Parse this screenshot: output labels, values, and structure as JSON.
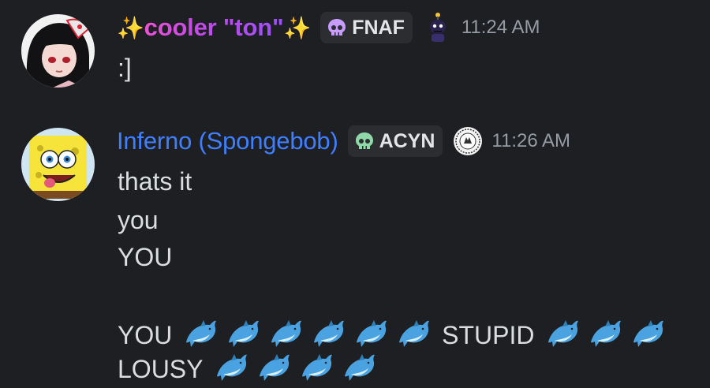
{
  "messages": [
    {
      "author": "cooler \"ton\"",
      "author_prefix": "✨",
      "author_suffix": "✨",
      "author_color": "#c64ae6",
      "tag": "FNAF",
      "tag_icon": "purple-skull-icon",
      "role_icon": "animatronic-icon",
      "time": "11:24 AM",
      "lines": [
        ":]"
      ]
    },
    {
      "author": "Inferno (Spongebob)",
      "author_color": "#3f7fff",
      "tag": "ACYN",
      "tag_icon": "green-skull-icon",
      "role_icon": "emblem-badge-icon",
      "time": "11:26 AM",
      "lines": [
        "thats it",
        "you",
        "YOU",
        "",
        "YOU",
        "STUPID",
        "LOUSY"
      ],
      "emoji": "dolphin"
    }
  ]
}
